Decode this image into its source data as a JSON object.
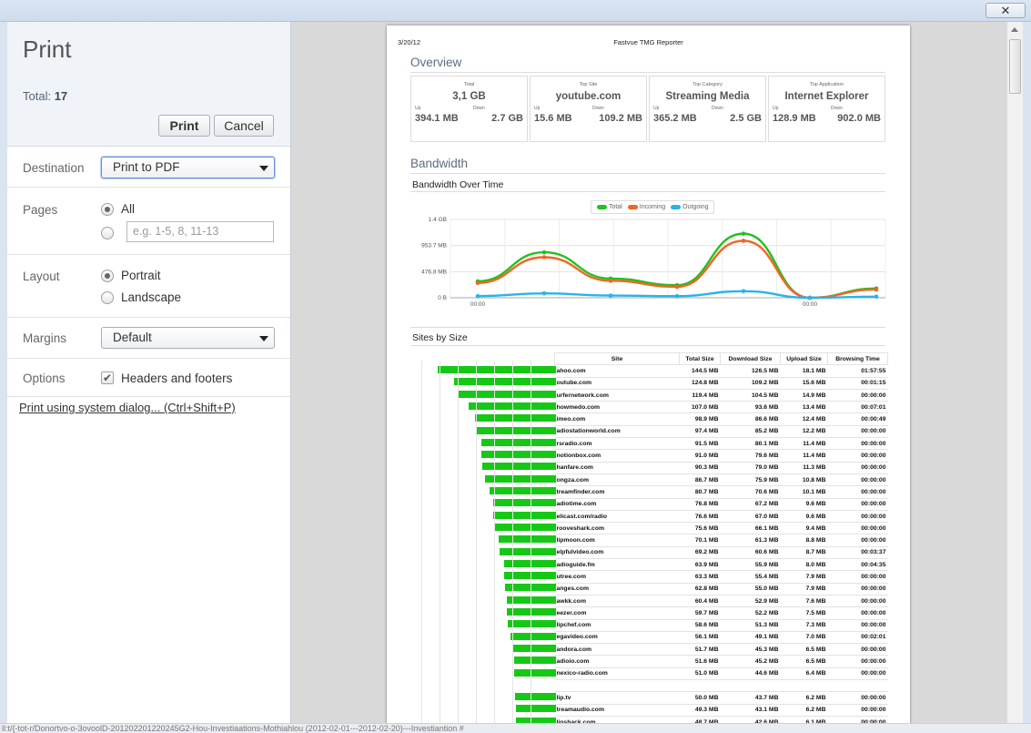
{
  "window": {
    "close_glyph": "✕"
  },
  "print_panel": {
    "title": "Print",
    "total_label": "Total:",
    "total_value": "17",
    "print_button": "Print",
    "cancel_button": "Cancel",
    "destination": {
      "label": "Destination",
      "value": "Print to PDF"
    },
    "pages": {
      "label": "Pages",
      "all_label": "All",
      "range_placeholder": "e.g. 1-5, 8, 11-13"
    },
    "layout": {
      "label": "Layout",
      "portrait": "Portrait",
      "landscape": "Landscape",
      "selected": "Portrait"
    },
    "margins": {
      "label": "Margins",
      "value": "Default"
    },
    "options": {
      "label": "Options",
      "headers_footers": "Headers and footers",
      "headers_footers_checked": true
    },
    "system_dialog_link": "Print using system dialog... (Ctrl+Shift+P)"
  },
  "report": {
    "date": "3/20/12",
    "title": "Fastvue TMG Reporter",
    "overview_title": "Overview",
    "cards": [
      {
        "key": "Total",
        "value": "3,1 GB",
        "up_label": "Up",
        "down_label": "Down",
        "up": "394.1 MB",
        "down": "2.7 GB"
      },
      {
        "key": "Top Site",
        "value": "youtube.com",
        "up_label": "Up",
        "down_label": "Down",
        "up": "15.6 MB",
        "down": "109.2 MB"
      },
      {
        "key": "Top Category",
        "value": "Streaming Media",
        "up_label": "Up",
        "down_label": "Down",
        "up": "365.2 MB",
        "down": "2.5 GB"
      },
      {
        "key": "Top Application",
        "value": "Internet Explorer",
        "up_label": "Up",
        "down_label": "Down",
        "up": "128.9 MB",
        "down": "902.0 MB"
      }
    ],
    "bandwidth_title": "Bandwidth",
    "bandwidth_over_time_title": "Bandwidth Over Time",
    "sites_by_size_title": "Sites by Size",
    "table_headers": [
      "Site",
      "Total Size",
      "Download Size",
      "Upload Size",
      "Browsing Time"
    ],
    "sites": [
      [
        "ahoo.com",
        "144.5 MB",
        "126.5 MB",
        "18.1 MB",
        "01:57:55"
      ],
      [
        "outube.com",
        "124.8 MB",
        "109.2 MB",
        "15.6 MB",
        "00:01:15"
      ],
      [
        "urfernetwork.com",
        "119.4 MB",
        "104.5 MB",
        "14.9 MB",
        "00:00:00"
      ],
      [
        "howmedo.com",
        "107.0 MB",
        "93.6 MB",
        "13.4 MB",
        "00:07:01"
      ],
      [
        "imeo.com",
        "98.9 MB",
        "86.6 MB",
        "12.4 MB",
        "00:00:49"
      ],
      [
        "adiostationworld.com",
        "97.4 MB",
        "85.2 MB",
        "12.2 MB",
        "00:00:00"
      ],
      [
        "rsradio.com",
        "91.5 MB",
        "80.1 MB",
        "11.4 MB",
        "00:00:00"
      ],
      [
        "notionbox.com",
        "91.0 MB",
        "79.6 MB",
        "11.4 MB",
        "00:00:00"
      ],
      [
        "hanfare.com",
        "90.3 MB",
        "79.0 MB",
        "11.3 MB",
        "00:00:00"
      ],
      [
        "ongza.com",
        "86.7 MB",
        "75.9 MB",
        "10.8 MB",
        "00:00:00"
      ],
      [
        "treamfinder.com",
        "80.7 MB",
        "70.6 MB",
        "10.1 MB",
        "00:00:00"
      ],
      [
        "adiotime.com",
        "76.8 MB",
        "67.2 MB",
        "9.6 MB",
        "00:00:00"
      ],
      [
        "elicast.com/radio",
        "76.6 MB",
        "67.0 MB",
        "9.6 MB",
        "00:00:00"
      ],
      [
        "rooveshark.com",
        "75.6 MB",
        "66.1 MB",
        "9.4 MB",
        "00:00:00"
      ],
      [
        "lipmoon.com",
        "70.1 MB",
        "61.3 MB",
        "8.8 MB",
        "00:00:00"
      ],
      [
        "elpfulvideo.com",
        "69.2 MB",
        "60.6 MB",
        "8.7 MB",
        "00:03:37"
      ],
      [
        "adioguide.fm",
        "63.9 MB",
        "55.9 MB",
        "8.0 MB",
        "00:04:35"
      ],
      [
        "utree.com",
        "63.3 MB",
        "55.4 MB",
        "7.9 MB",
        "00:00:00"
      ],
      [
        "anges.com",
        "62.8 MB",
        "55.0 MB",
        "7.9 MB",
        "00:00:00"
      ],
      [
        "awkk.com",
        "60.4 MB",
        "52.9 MB",
        "7.6 MB",
        "00:00:00"
      ],
      [
        "eezer.com",
        "59.7 MB",
        "52.2 MB",
        "7.5 MB",
        "00:00:00"
      ],
      [
        "lipchef.com",
        "58.6 MB",
        "51.3 MB",
        "7.3 MB",
        "00:00:00"
      ],
      [
        "egavideo.com",
        "56.1 MB",
        "49.1 MB",
        "7.0 MB",
        "00:02:01"
      ],
      [
        "andora.com",
        "51.7 MB",
        "45.3 MB",
        "6.5 MB",
        "00:00:00"
      ],
      [
        "adioio.com",
        "51.6 MB",
        "45.2 MB",
        "6.5 MB",
        "00:00:00"
      ],
      [
        "nexico-radio.com",
        "51.0 MB",
        "44.6 MB",
        "6.4 MB",
        "00:00:00"
      ],
      [
        "",
        "",
        "",
        "",
        ""
      ],
      [
        "lip.tv",
        "50.0 MB",
        "43.7 MB",
        "6.2 MB",
        "00:00:00"
      ],
      [
        "treamaudio.com",
        "49.3 MB",
        "43.1 MB",
        "6.2 MB",
        "00:00:00"
      ],
      [
        "lipshack.com",
        "48.7 MB",
        "42.6 MB",
        "6.1 MB",
        "00:00:00"
      ]
    ],
    "colors": {
      "total": "#22c11e",
      "incoming": "#f26522",
      "outgoing": "#2ab3ea",
      "bar": "#16c816"
    }
  },
  "chart_data": {
    "type": "line",
    "title": "Bandwidth Over Time",
    "legend": [
      "Total",
      "Incoming",
      "Outgoing"
    ],
    "legend_position": "top-center",
    "y_ticks": [
      "1.4 GB",
      "953.7 MB",
      "476.8 MB",
      "0 B"
    ],
    "x_ticks": [
      "00:00",
      "00:00"
    ],
    "ylim_mb": [
      0,
      1430
    ],
    "x": [
      0,
      1,
      2,
      3,
      4,
      5,
      6
    ],
    "series": [
      {
        "name": "Total",
        "values": [
          300,
          830,
          350,
          230,
          1170,
          0,
          170
        ]
      },
      {
        "name": "Incoming",
        "values": [
          270,
          740,
          310,
          200,
          1040,
          0,
          150
        ]
      },
      {
        "name": "Outgoing",
        "values": [
          30,
          80,
          40,
          30,
          120,
          0,
          20
        ]
      }
    ]
  },
  "status_bar": "ll:t/{-tot-r/Donortvo-o-3ovoolD-201202201220245G2-Hou-Investiaations-Mothiahlou (2012-02-01---2012-02-20)---Investiantion #"
}
